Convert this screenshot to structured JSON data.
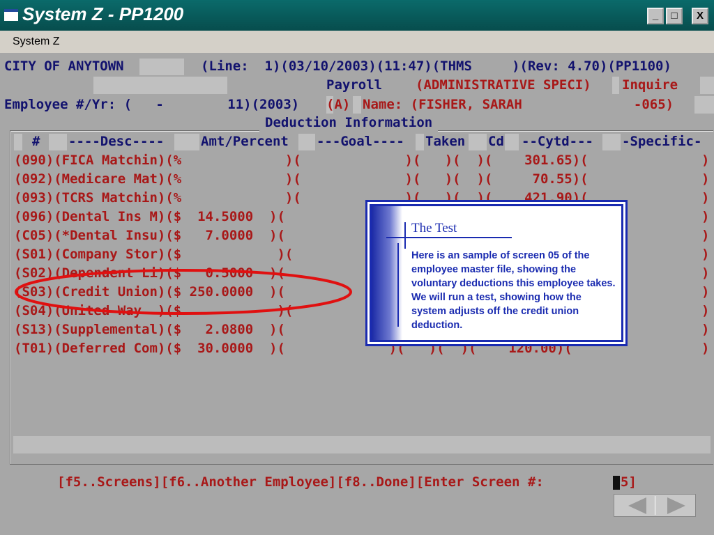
{
  "window": {
    "title": "System Z - PP1200",
    "min": "_",
    "max": "□",
    "close": "X"
  },
  "menu": {
    "system": "System Z"
  },
  "header": {
    "city": "CITY OF ANYTOWN",
    "status_line": "(Line:  1)(03/10/2003)(11:47)(THMS     )(Rev: 4.70)(PP1100)",
    "payroll": "Payroll",
    "position": "(ADMINISTRATIVE SPECI)",
    "mode": "Inquire",
    "emp_label": "Employee #/Yr: (   -        11)(2003)",
    "emp_a": "(A)",
    "name_label": "Name: (FISHER, SARAH              -065)"
  },
  "section": {
    "title": "Deduction Information"
  },
  "columns": {
    "num": "#",
    "desc": "----Desc----",
    "amt": "Amt/Percent",
    "goal": "---Goal----",
    "taken": "Taken",
    "cd": "Cd",
    "cytd": "--Cytd---",
    "specific": "-Specific-"
  },
  "rows": [
    "(090)(FICA Matchin)(%             )(             )(   )(  )(    301.65)(",
    "(092)(Medicare Mat)(%             )(             )(   )(  )(     70.55)(",
    "(093)(TCRS Matchin)(%             )(             )(   )(  )(    421.90)(",
    "(096)(Dental Ins M)($  14.5000  )(",
    "(C05)(*Dental Insu)($   7.0000  )(",
    "(S01)(Company Stor)($            )(",
    "(S02)(Dependent Li)($   0.5000  )(",
    "(S03)(Credit Union)($ 250.0000  )(",
    "(S04)(United Way  )($            )(",
    "(S13)(Supplemental)($   2.0800  )(",
    "(T01)(Deferred Com)($  30.0000  )(             )(   )(  )(    120.00)("
  ],
  "row_close": ")",
  "footer": {
    "fkeys": "[f5..Screens][f6..Another Employee][f8..Done][Enter Screen #: ",
    "screen_num": "5]"
  },
  "popup": {
    "title": "The Test",
    "body": "Here is an sample of screen 05 of the employee master file, showing the voluntary deductions this employee takes.  We will run a test, showing how the system adjusts off the credit union deduction."
  },
  "colors": {
    "navy": "#12126e",
    "red": "#a81818",
    "titlebar": "#0a6a6a",
    "popup_blue": "#1a2bb0",
    "highlight": "#e01010"
  },
  "icons": [
    "window-icon",
    "minimize-icon",
    "maximize-icon",
    "close-icon",
    "prev-arrow-icon",
    "next-arrow-icon"
  ]
}
